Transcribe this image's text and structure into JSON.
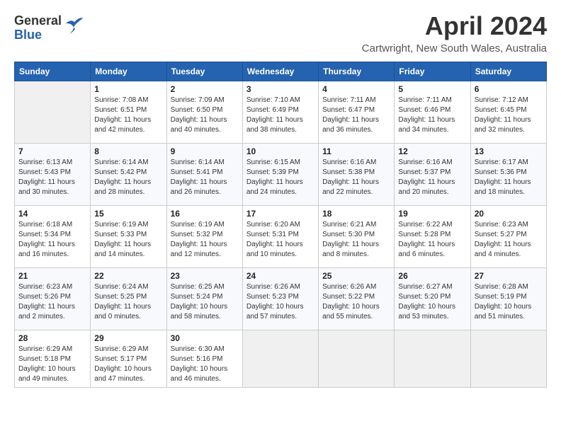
{
  "header": {
    "logo_general": "General",
    "logo_blue": "Blue",
    "title": "April 2024",
    "subtitle": "Cartwright, New South Wales, Australia"
  },
  "calendar": {
    "days_of_week": [
      "Sunday",
      "Monday",
      "Tuesday",
      "Wednesday",
      "Thursday",
      "Friday",
      "Saturday"
    ],
    "weeks": [
      [
        {
          "day": "",
          "info": ""
        },
        {
          "day": "1",
          "info": "Sunrise: 7:08 AM\nSunset: 6:51 PM\nDaylight: 11 hours\nand 42 minutes."
        },
        {
          "day": "2",
          "info": "Sunrise: 7:09 AM\nSunset: 6:50 PM\nDaylight: 11 hours\nand 40 minutes."
        },
        {
          "day": "3",
          "info": "Sunrise: 7:10 AM\nSunset: 6:49 PM\nDaylight: 11 hours\nand 38 minutes."
        },
        {
          "day": "4",
          "info": "Sunrise: 7:11 AM\nSunset: 6:47 PM\nDaylight: 11 hours\nand 36 minutes."
        },
        {
          "day": "5",
          "info": "Sunrise: 7:11 AM\nSunset: 6:46 PM\nDaylight: 11 hours\nand 34 minutes."
        },
        {
          "day": "6",
          "info": "Sunrise: 7:12 AM\nSunset: 6:45 PM\nDaylight: 11 hours\nand 32 minutes."
        }
      ],
      [
        {
          "day": "7",
          "info": "Sunrise: 6:13 AM\nSunset: 5:43 PM\nDaylight: 11 hours\nand 30 minutes."
        },
        {
          "day": "8",
          "info": "Sunrise: 6:14 AM\nSunset: 5:42 PM\nDaylight: 11 hours\nand 28 minutes."
        },
        {
          "day": "9",
          "info": "Sunrise: 6:14 AM\nSunset: 5:41 PM\nDaylight: 11 hours\nand 26 minutes."
        },
        {
          "day": "10",
          "info": "Sunrise: 6:15 AM\nSunset: 5:39 PM\nDaylight: 11 hours\nand 24 minutes."
        },
        {
          "day": "11",
          "info": "Sunrise: 6:16 AM\nSunset: 5:38 PM\nDaylight: 11 hours\nand 22 minutes."
        },
        {
          "day": "12",
          "info": "Sunrise: 6:16 AM\nSunset: 5:37 PM\nDaylight: 11 hours\nand 20 minutes."
        },
        {
          "day": "13",
          "info": "Sunrise: 6:17 AM\nSunset: 5:36 PM\nDaylight: 11 hours\nand 18 minutes."
        }
      ],
      [
        {
          "day": "14",
          "info": "Sunrise: 6:18 AM\nSunset: 5:34 PM\nDaylight: 11 hours\nand 16 minutes."
        },
        {
          "day": "15",
          "info": "Sunrise: 6:19 AM\nSunset: 5:33 PM\nDaylight: 11 hours\nand 14 minutes."
        },
        {
          "day": "16",
          "info": "Sunrise: 6:19 AM\nSunset: 5:32 PM\nDaylight: 11 hours\nand 12 minutes."
        },
        {
          "day": "17",
          "info": "Sunrise: 6:20 AM\nSunset: 5:31 PM\nDaylight: 11 hours\nand 10 minutes."
        },
        {
          "day": "18",
          "info": "Sunrise: 6:21 AM\nSunset: 5:30 PM\nDaylight: 11 hours\nand 8 minutes."
        },
        {
          "day": "19",
          "info": "Sunrise: 6:22 AM\nSunset: 5:28 PM\nDaylight: 11 hours\nand 6 minutes."
        },
        {
          "day": "20",
          "info": "Sunrise: 6:23 AM\nSunset: 5:27 PM\nDaylight: 11 hours\nand 4 minutes."
        }
      ],
      [
        {
          "day": "21",
          "info": "Sunrise: 6:23 AM\nSunset: 5:26 PM\nDaylight: 11 hours\nand 2 minutes."
        },
        {
          "day": "22",
          "info": "Sunrise: 6:24 AM\nSunset: 5:25 PM\nDaylight: 11 hours\nand 0 minutes."
        },
        {
          "day": "23",
          "info": "Sunrise: 6:25 AM\nSunset: 5:24 PM\nDaylight: 10 hours\nand 58 minutes."
        },
        {
          "day": "24",
          "info": "Sunrise: 6:26 AM\nSunset: 5:23 PM\nDaylight: 10 hours\nand 57 minutes."
        },
        {
          "day": "25",
          "info": "Sunrise: 6:26 AM\nSunset: 5:22 PM\nDaylight: 10 hours\nand 55 minutes."
        },
        {
          "day": "26",
          "info": "Sunrise: 6:27 AM\nSunset: 5:20 PM\nDaylight: 10 hours\nand 53 minutes."
        },
        {
          "day": "27",
          "info": "Sunrise: 6:28 AM\nSunset: 5:19 PM\nDaylight: 10 hours\nand 51 minutes."
        }
      ],
      [
        {
          "day": "28",
          "info": "Sunrise: 6:29 AM\nSunset: 5:18 PM\nDaylight: 10 hours\nand 49 minutes."
        },
        {
          "day": "29",
          "info": "Sunrise: 6:29 AM\nSunset: 5:17 PM\nDaylight: 10 hours\nand 47 minutes."
        },
        {
          "day": "30",
          "info": "Sunrise: 6:30 AM\nSunset: 5:16 PM\nDaylight: 10 hours\nand 46 minutes."
        },
        {
          "day": "",
          "info": ""
        },
        {
          "day": "",
          "info": ""
        },
        {
          "day": "",
          "info": ""
        },
        {
          "day": "",
          "info": ""
        }
      ]
    ]
  }
}
